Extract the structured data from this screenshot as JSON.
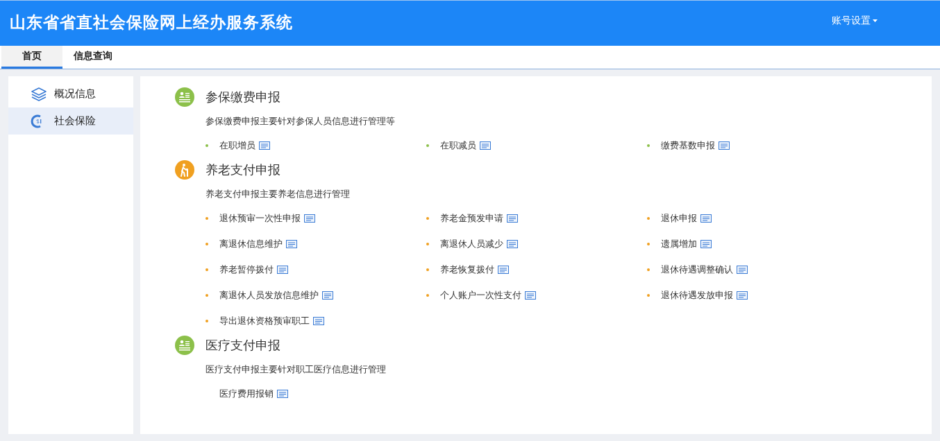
{
  "header": {
    "title": "山东省省直社会保险网上经办服务系统",
    "account_menu": "账号设置"
  },
  "tabs": [
    {
      "label": "首页",
      "selected": true
    },
    {
      "label": "信息查询",
      "selected": false
    }
  ],
  "sidebar": {
    "items": [
      {
        "label": "概况信息",
        "kind": "layers",
        "selected": false
      },
      {
        "label": "社会保险",
        "kind": "si",
        "selected": true
      }
    ]
  },
  "sections": [
    {
      "title": "参保缴费申报",
      "kind": "person-card",
      "color": "#8cc04a",
      "description": "参保缴费申报主要针对参保人员信息进行管理等",
      "bullets": true,
      "items": [
        "在职增员",
        "在职减员",
        "缴费基数申报"
      ]
    },
    {
      "title": "养老支付申报",
      "kind": "elderly",
      "color": "#f0a020",
      "description": "养老支付申报主要养老信息进行管理",
      "bullets": true,
      "items": [
        "退休预审一次性申报",
        "养老金预发申请",
        "退休申报",
        "离退休信息维护",
        "离退休人员减少",
        "遗属增加",
        "养老暂停拨付",
        "养老恢复拨付",
        "退休待遇调整确认",
        "离退休人员发放信息维护",
        "个人账户一次性支付",
        "退休待遇发放申报",
        "导出退休资格预审职工"
      ]
    },
    {
      "title": "医疗支付申报",
      "kind": "person-card",
      "color": "#8cc04a",
      "description": "医疗支付申报主要针对职工医疗信息进行管理",
      "bullets": false,
      "items": [
        "医疗费用报销"
      ]
    }
  ]
}
